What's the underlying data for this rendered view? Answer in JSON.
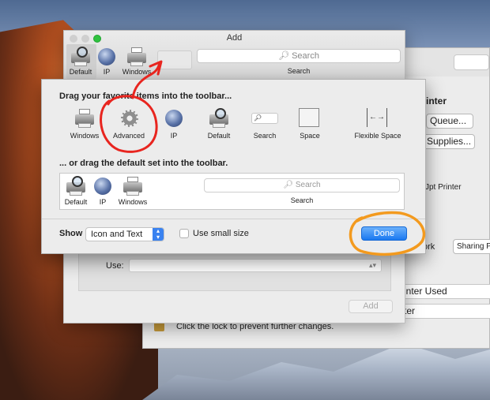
{
  "colors": {
    "done_blue": "#1a78f0",
    "annotation_red": "#e8251f",
    "annotation_orange": "#f39a1e"
  },
  "back_window": {
    "heading": "inter",
    "queue_button": "Queue...",
    "supplies_button": "Supplies...",
    "printer_text": "Jpt Printer",
    "network_text": "ork",
    "sharing_button": "Sharing P",
    "last_used_field": "inter Used",
    "second_field": "ter",
    "lock_text": "Click the lock to prevent further changes."
  },
  "add_window": {
    "title": "Add",
    "toolbar": {
      "items": [
        {
          "label": "Default",
          "icon": "default-icon"
        },
        {
          "label": "IP",
          "icon": "globe-icon"
        },
        {
          "label": "Windows",
          "icon": "printer-icon"
        }
      ],
      "search_placeholder": "Search",
      "search_label": "Search"
    },
    "use_label": "Use:",
    "add_button": "Add"
  },
  "customize_sheet": {
    "heading": "Drag your favorite items into the toolbar...",
    "items": [
      {
        "label": "Windows",
        "icon": "printer-icon"
      },
      {
        "label": "Advanced",
        "icon": "gear-icon"
      },
      {
        "label": "IP",
        "icon": "globe-icon"
      },
      {
        "label": "Default",
        "icon": "default-icon"
      },
      {
        "label": "Search",
        "icon": "search-field-icon"
      },
      {
        "label": "Space",
        "icon": "space-icon"
      },
      {
        "label": "Flexible Space",
        "icon": "flexible-space-icon"
      }
    ],
    "default_set_heading": "... or drag the default set into the toolbar.",
    "default_set": {
      "items": [
        {
          "label": "Default",
          "icon": "default-icon"
        },
        {
          "label": "IP",
          "icon": "globe-icon"
        },
        {
          "label": "Windows",
          "icon": "printer-icon"
        }
      ],
      "search_placeholder": "Search",
      "search_label": "Search"
    },
    "show_label": "Show",
    "show_select_value": "Icon and Text",
    "small_size_label": "Use small size",
    "small_size_checked": false,
    "done_button": "Done"
  }
}
